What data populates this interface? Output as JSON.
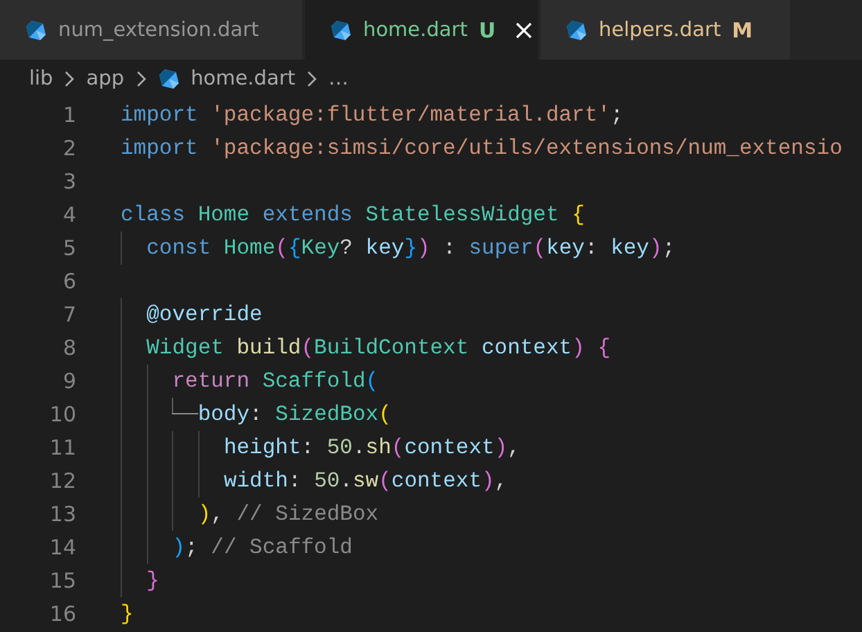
{
  "tabs": [
    {
      "label": "num_extension.dart",
      "selected": false
    },
    {
      "label": "home.dart",
      "badge": "U",
      "color": "#73c991",
      "selected": true
    },
    {
      "label": "helpers.dart",
      "badge": "M",
      "color": "#e2c08d",
      "selected": false
    }
  ],
  "breadcrumb": [
    {
      "kind": "folder",
      "label": "lib"
    },
    {
      "kind": "folder",
      "label": "app"
    },
    {
      "kind": "file",
      "label": "home.dart"
    },
    {
      "kind": "more",
      "label": "…"
    }
  ],
  "code": [
    {
      "number": "1",
      "tokens": [
        {
          "kind": "k",
          "text": "import"
        },
        {
          "kind": "s",
          "text": " 'package:flutter/material.dart'"
        },
        {
          "kind": "p",
          "text": ";"
        }
      ]
    },
    {
      "number": "2",
      "tokens": [
        {
          "kind": "k",
          "text": "import"
        },
        {
          "kind": "s",
          "text": " 'package:simsi/core/utils/extensions/num_extensio"
        }
      ]
    },
    {
      "number": "3"
    },
    {
      "number": "4",
      "tokens": [
        {
          "kind": "k",
          "text": "class"
        },
        {
          "kind": "t",
          "text": " Home"
        },
        {
          "kind": "k",
          "text": " extends"
        },
        {
          "kind": "t",
          "text": " StatelessWidget"
        },
        {
          "kind": "b1",
          "text": " {"
        }
      ]
    },
    {
      "number": "5",
      "tokens": [
        {
          "kind": "k",
          "text": "  const"
        },
        {
          "kind": "t",
          "text": " Home"
        },
        {
          "kind": "b2",
          "text": "("
        },
        {
          "kind": "b3",
          "text": "{"
        },
        {
          "kind": "t",
          "text": "Key"
        },
        {
          "kind": "p",
          "text": "?"
        },
        {
          "kind": "v",
          "text": " key"
        },
        {
          "kind": "b3",
          "text": "}"
        },
        {
          "kind": "b2",
          "text": ")"
        },
        {
          "kind": "p",
          "text": " :"
        },
        {
          "kind": "k",
          "text": " super"
        },
        {
          "kind": "b2",
          "text": "("
        },
        {
          "kind": "v",
          "text": "key"
        },
        {
          "kind": "p",
          "text": ":"
        },
        {
          "kind": "v",
          "text": " key"
        },
        {
          "kind": "b2",
          "text": ")"
        },
        {
          "kind": "p",
          "text": ";"
        }
      ]
    },
    {
      "number": "6"
    },
    {
      "number": "7",
      "tokens": [
        {
          "kind": "v",
          "text": "  @override"
        }
      ]
    },
    {
      "number": "8",
      "tokens": [
        {
          "kind": "t",
          "text": "  Widget"
        },
        {
          "kind": "f",
          "text": " build"
        },
        {
          "kind": "b2",
          "text": "("
        },
        {
          "kind": "t",
          "text": "BuildContext"
        },
        {
          "kind": "v",
          "text": " context"
        },
        {
          "kind": "b2",
          "text": ")"
        },
        {
          "kind": "b2",
          "text": " {"
        }
      ]
    },
    {
      "number": "9",
      "tokens": [
        {
          "kind": "c",
          "text": "    return"
        },
        {
          "kind": "t",
          "text": " Scaffold"
        },
        {
          "kind": "b3",
          "text": "("
        }
      ]
    },
    {
      "number": "10",
      "tokens": [
        {
          "kind": "elbow"
        },
        {
          "kind": "v",
          "text": "body"
        },
        {
          "kind": "p",
          "text": ":"
        },
        {
          "kind": "t",
          "text": " SizedBox"
        },
        {
          "kind": "b1",
          "text": "("
        }
      ]
    },
    {
      "number": "11",
      "tokens": [
        {
          "kind": "v",
          "text": "        height"
        },
        {
          "kind": "p",
          "text": ":"
        },
        {
          "kind": "n",
          "text": " 50"
        },
        {
          "kind": "p",
          "text": "."
        },
        {
          "kind": "f",
          "text": "sh"
        },
        {
          "kind": "b2",
          "text": "("
        },
        {
          "kind": "v",
          "text": "context"
        },
        {
          "kind": "b2",
          "text": ")"
        },
        {
          "kind": "p",
          "text": ","
        }
      ]
    },
    {
      "number": "12",
      "tokens": [
        {
          "kind": "v",
          "text": "        width"
        },
        {
          "kind": "p",
          "text": ":"
        },
        {
          "kind": "n",
          "text": " 50"
        },
        {
          "kind": "p",
          "text": "."
        },
        {
          "kind": "f",
          "text": "sw"
        },
        {
          "kind": "b2",
          "text": "("
        },
        {
          "kind": "v",
          "text": "context"
        },
        {
          "kind": "b2",
          "text": ")"
        },
        {
          "kind": "p",
          "text": ","
        }
      ]
    },
    {
      "number": "13",
      "tokens": [
        {
          "kind": "b1",
          "text": "      )"
        },
        {
          "kind": "p",
          "text": ","
        },
        {
          "kind": "m",
          "text": " // SizedBox"
        }
      ]
    },
    {
      "number": "14",
      "tokens": [
        {
          "kind": "b3",
          "text": "    )"
        },
        {
          "kind": "p",
          "text": ";"
        },
        {
          "kind": "m",
          "text": " // Scaffold"
        }
      ]
    },
    {
      "number": "15",
      "tokens": [
        {
          "kind": "b2",
          "text": "  }"
        }
      ]
    },
    {
      "number": "16",
      "tokens": [
        {
          "kind": "b1",
          "text": "}"
        }
      ]
    }
  ]
}
